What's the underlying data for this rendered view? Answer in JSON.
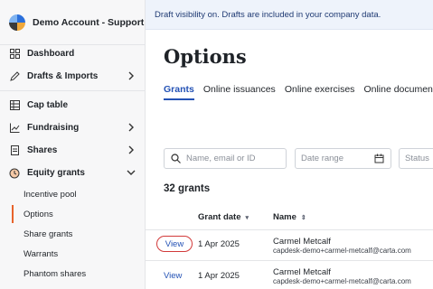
{
  "sidebar": {
    "account_name": "Demo Account - Support",
    "items": [
      {
        "label": "Dashboard",
        "icon": "grid-icon"
      },
      {
        "label": "Drafts & Imports",
        "icon": "pencil-icon",
        "expandable": true
      },
      {
        "label": "Cap table",
        "icon": "table-icon"
      },
      {
        "label": "Fundraising",
        "icon": "chart-icon",
        "expandable": true
      },
      {
        "label": "Shares",
        "icon": "document-icon",
        "expandable": true
      },
      {
        "label": "Equity grants",
        "icon": "clock-icon",
        "expanded": true
      }
    ],
    "sub_items": [
      {
        "label": "Incentive pool"
      },
      {
        "label": "Options",
        "active": true
      },
      {
        "label": "Share grants"
      },
      {
        "label": "Warrants"
      },
      {
        "label": "Phantom shares"
      }
    ]
  },
  "banner": "Draft visibility on. Drafts are included in your company data.",
  "page_title": "Options",
  "tabs": [
    "Grants",
    "Online issuances",
    "Online exercises",
    "Online documen"
  ],
  "filters": {
    "search_placeholder": "Name, email or ID",
    "date_placeholder": "Date range",
    "status_placeholder": "Status"
  },
  "grants_count": "32 grants",
  "table": {
    "columns": [
      "Grant date",
      "Name"
    ],
    "rows": [
      {
        "action": "View",
        "date": "1 Apr 2025",
        "name": "Carmel Metcalf",
        "email": "capdesk-demo+carmel-metcalf@carta.com"
      },
      {
        "action": "View",
        "date": "1 Apr 2025",
        "name": "Carmel Metcalf",
        "email": "capdesk-demo+carmel-metcalf@carta.com"
      }
    ]
  },
  "colors": {
    "accent": "#2452b5",
    "active_marker": "#e8632b",
    "highlight_circle": "#d23a3a"
  }
}
